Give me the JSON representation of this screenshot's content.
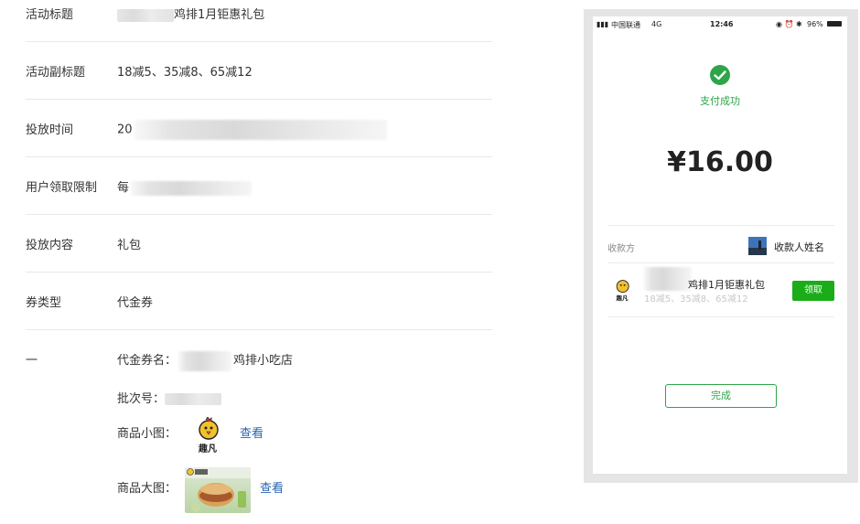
{
  "form": {
    "rows": [
      {
        "label": "活动标题",
        "value": "鸡排1月钜惠礼包"
      },
      {
        "label": "活动副标题",
        "value": "18减5、35减8、65减12"
      },
      {
        "label": "投放时间",
        "value": "20"
      },
      {
        "label": "用户领取限制",
        "value": "每"
      },
      {
        "label": "投放内容",
        "value": "礼包"
      },
      {
        "label": "券类型",
        "value": "代金券"
      }
    ],
    "detail": {
      "label": "一",
      "coupon_name_label": "代金券名：",
      "coupon_name_value": "鸡排小吃店",
      "batch_label": "批次号：",
      "small_img_label": "商品小图：",
      "small_img_link": "查看",
      "large_img_label": "商品大图：",
      "large_img_link": "查看",
      "brand_text": "趣凡"
    }
  },
  "phone": {
    "status": {
      "carrier": "中国联通",
      "network": "4G",
      "time": "12:46",
      "battery": "96%"
    },
    "pay_success": "支付成功",
    "amount": "¥16.00",
    "payee_label": "收款方",
    "payee_name": "收款人姓名",
    "gift_title": "鸡排1月钜惠礼包",
    "gift_subtitle": "18减5、35减8、65减12",
    "brand_text": "趣凡",
    "receive_button": "领取",
    "done_button": "完成"
  },
  "colors": {
    "wechat_green": "#1aad19",
    "link_blue": "#2a63b3",
    "divider": "#e8e8e8"
  }
}
